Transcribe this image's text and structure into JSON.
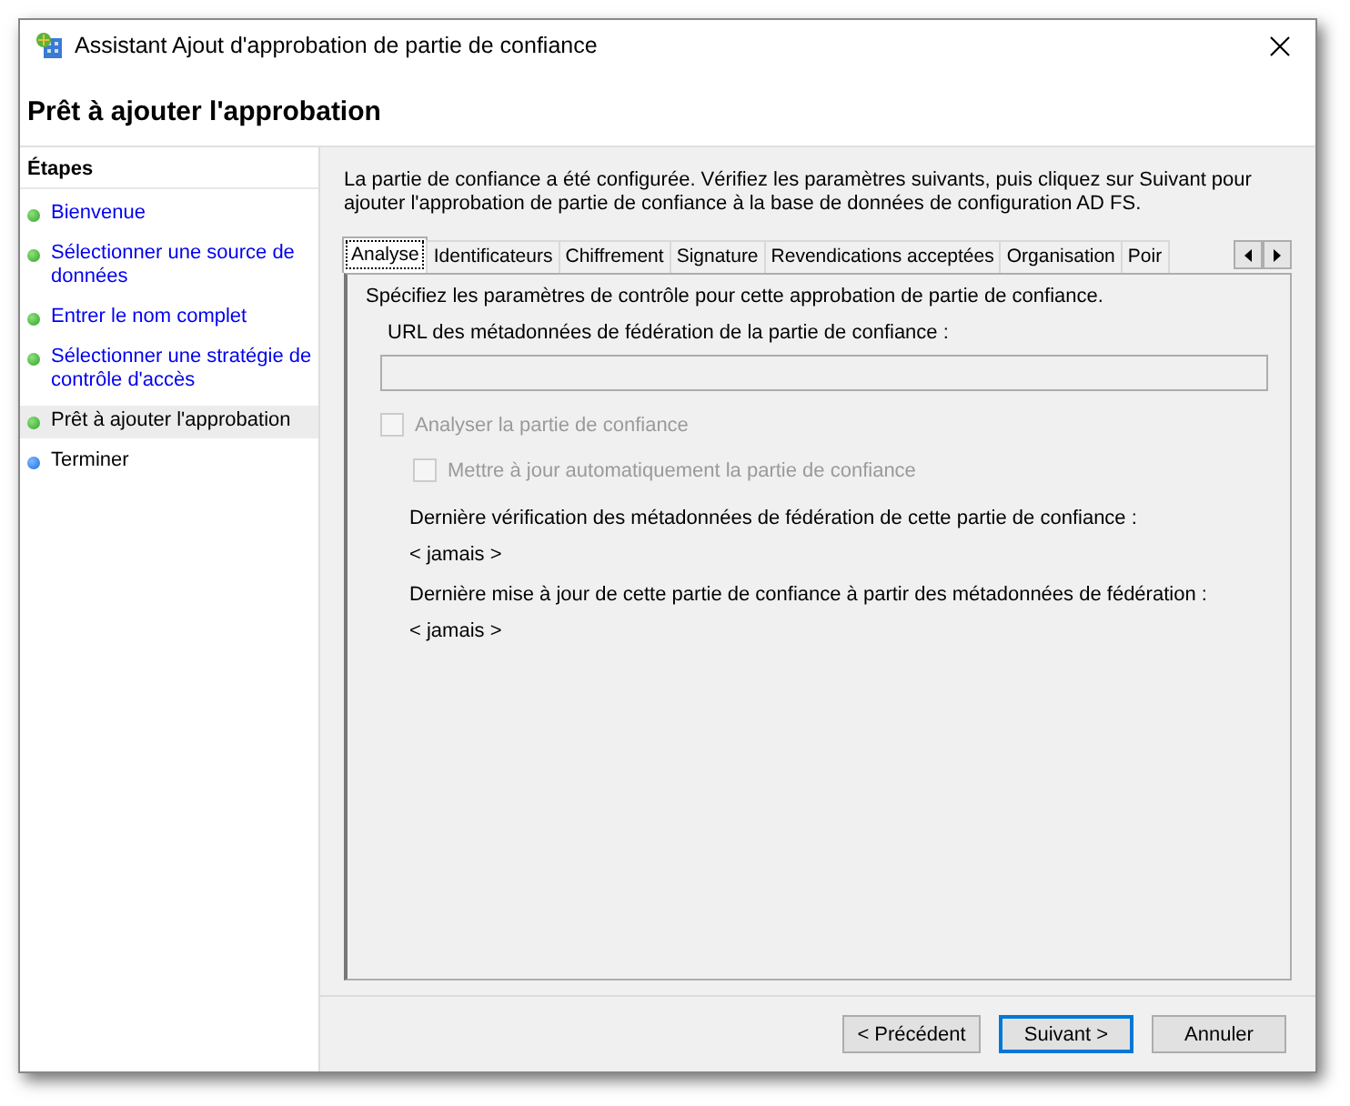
{
  "window": {
    "title": "Assistant Ajout d'approbation de partie de confiance"
  },
  "header": {
    "title": "Prêt à ajouter l'approbation"
  },
  "sidebar": {
    "title": "Étapes",
    "items": [
      {
        "label": "Bienvenue",
        "completed": true,
        "selected": false
      },
      {
        "label": "Sélectionner une source de données",
        "completed": true,
        "selected": false
      },
      {
        "label": "Entrer le nom complet",
        "completed": true,
        "selected": false
      },
      {
        "label": "Sélectionner une stratégie de contrôle d'accès",
        "completed": true,
        "selected": false
      },
      {
        "label": "Prêt à ajouter l'approbation",
        "completed": true,
        "selected": true
      },
      {
        "label": "Terminer",
        "completed": false,
        "selected": false
      }
    ]
  },
  "intro": "La partie de confiance a été configurée. Vérifiez les paramètres suivants, puis cliquez sur Suivant pour ajouter l'approbation de partie de confiance à la base de données de configuration AD FS.",
  "tabs": [
    {
      "label": "Analyse",
      "selected": true
    },
    {
      "label": "Identificateurs",
      "selected": false
    },
    {
      "label": "Chiffrement",
      "selected": false
    },
    {
      "label": "Signature",
      "selected": false
    },
    {
      "label": "Revendications acceptées",
      "selected": false
    },
    {
      "label": "Organisation",
      "selected": false
    },
    {
      "label": "Poir",
      "selected": false
    }
  ],
  "panel": {
    "description": "Spécifiez les paramètres de contrôle pour cette approbation de partie de confiance.",
    "url_label": "URL des métadonnées de fédération de la partie de confiance :",
    "checkboxes": [
      {
        "label": "Analyser la partie de confiance",
        "checked": false,
        "disabled": true,
        "children": [
          {
            "label": "Mettre à jour automatiquement la partie de confiance",
            "checked": false,
            "disabled": true
          }
        ]
      }
    ],
    "fields": [
      {
        "label": "Dernière vérification des métadonnées de fédération de cette partie de confiance :",
        "value": "< jamais >"
      },
      {
        "label": "Dernière mise à jour de cette partie de confiance à partir des métadonnées de fédération :",
        "value": "< jamais >"
      }
    ]
  },
  "buttons": [
    {
      "label": "< Précédent",
      "default": false
    },
    {
      "label": "Suivant >",
      "default": true
    },
    {
      "label": "Annuler",
      "default": false
    }
  ]
}
